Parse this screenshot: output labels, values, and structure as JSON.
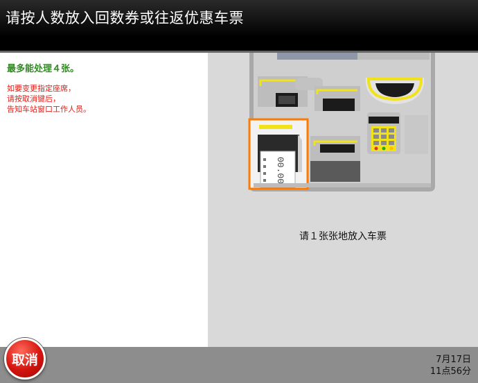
{
  "header": {
    "title": "请按人数放入回数券或往返优惠车票"
  },
  "left": {
    "max_text": "最多能处理４张。",
    "notice_lines": [
      "如要变更指定座席，",
      "请按取消键后，",
      "告知车站窗口工作人员。"
    ]
  },
  "right": {
    "instruction": "请１张张地放入车票"
  },
  "ticket": {
    "digits": "00.00"
  },
  "footer": {
    "cancel_label": "取消",
    "date": "7月17日",
    "time": "11点56分"
  },
  "colors": {
    "accent_green": "#2e8b20",
    "notice_red": "#e0201a",
    "highlight_orange": "#ff7a00",
    "slot_yellow": "#f2e21a"
  }
}
